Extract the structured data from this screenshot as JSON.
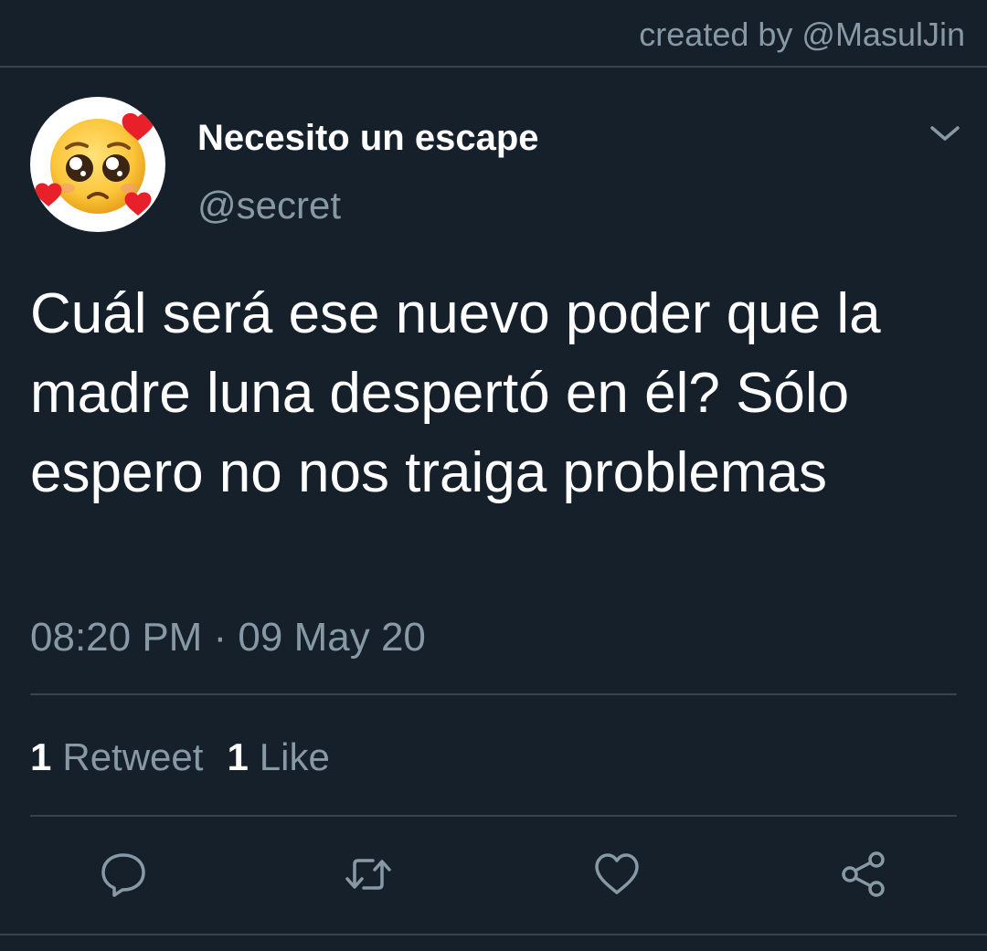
{
  "credit": "created by @MasulJin",
  "author": {
    "display_name": "Necesito un escape",
    "handle": "@secret",
    "avatar_icon": "pleading-face-with-hearts-emoji"
  },
  "tweet": {
    "text": "Cuál será ese nuevo poder que la madre luna despertó en él? Sólo espero no nos traiga problemas",
    "timestamp": "08:20 PM · 09 May 20"
  },
  "stats": {
    "retweets_count": "1",
    "retweets_label": "Retweet",
    "likes_count": "1",
    "likes_label": "Like"
  },
  "actions": [
    "reply-icon",
    "retweet-icon",
    "like-icon",
    "share-icon"
  ],
  "colors": {
    "background": "#15202b",
    "text": "#ffffff",
    "secondary_text": "#8899a6",
    "divider": "#38444d"
  }
}
